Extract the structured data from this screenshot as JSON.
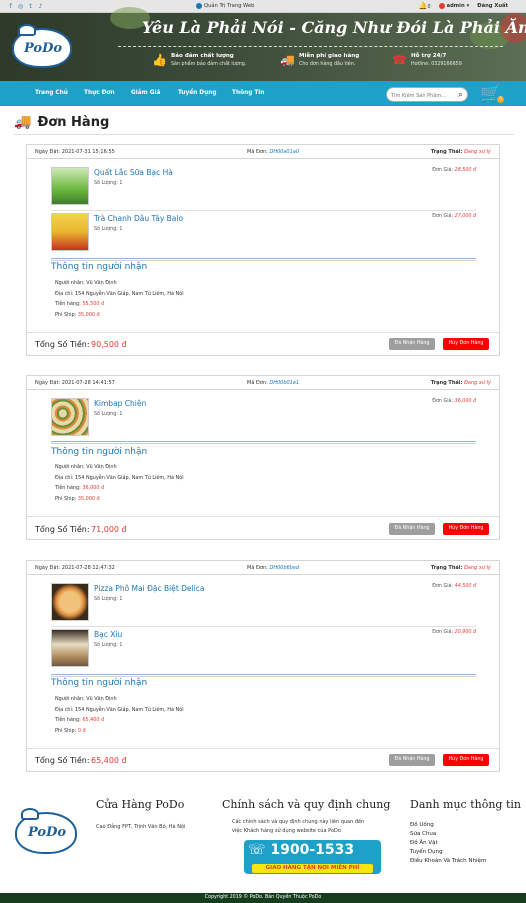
{
  "topbar": {
    "admin_link": "Quản Trị Trang Web",
    "bell_count": "0",
    "user_count": "0",
    "user_name": "admin",
    "logout": "Đăng Xuất"
  },
  "header": {
    "logo_text": "PoDo",
    "slogan": "Yêu Là Phải Nói - Căng Như Đói Là Phải Ăn",
    "features": [
      {
        "title": "Bảo đảm chất lượng",
        "desc": "Sản phẩm bảo đảm chất lượng."
      },
      {
        "title": "Miễn phí giao hàng",
        "desc": "Cho đơn hàng đầu tiên."
      },
      {
        "title": "Hỗ trợ 24/7",
        "desc": "Hotline: 0329166659"
      }
    ]
  },
  "nav": {
    "items": [
      "Trang Chủ",
      "Thực Đơn",
      "Giảm Giá",
      "Tuyển Dụng",
      "Thông Tin"
    ],
    "search_placeholder": "Tìm Kiếm Sản Phẩm...",
    "cart_count": "0"
  },
  "page": {
    "title": "Đơn Hàng"
  },
  "labels": {
    "order_date": "Ngày Đặt:",
    "order_code": "Mã Đơn:",
    "status": "Trạng Thái:",
    "price": "Đơn Giá:",
    "qty": "Số Lượng:",
    "recipient_title": "Thông tin người nhận",
    "recipient": "Người nhận:",
    "address": "Địa chỉ:",
    "goods": "Tiền hàng:",
    "ship": "Phí Ship:",
    "total": "Tổng Số Tiền:",
    "received_btn": "Đã Nhận Hàng",
    "cancel_btn": "Hủy Đơn Hàng"
  },
  "orders": [
    {
      "date": "2021-07-31 15:16:55",
      "code": "DH00a01a0",
      "status": "Đang xử lý",
      "products": [
        {
          "name": "Quất Lắc Sữa Bạc Hà",
          "qty": "1",
          "price": "28,500 đ"
        },
        {
          "name": "Trà Chanh Dâu Tây Balo",
          "qty": "1",
          "price": "27,000 đ"
        }
      ],
      "recipient": "Vũ Văn Định",
      "address": "154 Nguyễn Văn Giáp, Nam Từ Liêm, Hà Nội",
      "goods": "55,500 đ",
      "ship": "35,000 đ",
      "total": "90,500 đ"
    },
    {
      "date": "2021-07-28 14:41:57",
      "code": "DH00b01e1",
      "status": "Đang xử lý",
      "products": [
        {
          "name": "Kimbap Chiên",
          "qty": "1",
          "price": "36,000 đ"
        }
      ],
      "recipient": "Vũ Văn Định",
      "address": "154 Nguyễn Văn Giáp, Nam Từ Liêm, Hà Nội",
      "goods": "36,000 đ",
      "ship": "35,000 đ",
      "total": "71,000 đ"
    },
    {
      "date": "2021-07-28 12:47:32",
      "code": "DH00b6bed",
      "status": "Đang xử lý",
      "products": [
        {
          "name": "Pizza Phô Mai Đặc Biệt Delica",
          "qty": "1",
          "price": "44,500 đ"
        },
        {
          "name": "Bạc Xỉu",
          "qty": "1",
          "price": "20,900 đ"
        }
      ],
      "recipient": "Vũ Văn Định",
      "address": "154 Nguyễn Văn Giáp, Nam Từ Liêm, Hà Nội",
      "goods": "65,400 đ",
      "ship": "0 đ",
      "total": "65,400 đ"
    }
  ],
  "footer": {
    "store_title": "Cửa Hàng PoDo",
    "store_address": "Cao Đẳng FPT, Trịnh Văn Bô, Hà Nội",
    "policy_title": "Chính sách và quy định chung",
    "policy_text_1": "Các chính sách và quy định chung này liên quan đến",
    "policy_text_2": "việc Khách hàng sử dụng website của PoDo",
    "hotline": "1900-1533",
    "hotline_sub": "GIAO HÀNG TẬN NƠI MIỄN PHÍ",
    "category_title": "Danh mục thông tin",
    "categories": [
      "Đồ Uống",
      "Sữa Chua",
      "Đồ Ăn Vặt",
      "Tuyển Dụng",
      "Điều Khoản Và Trách Nhiệm"
    ],
    "copyright": "Copyright 2019 © PoDo. Bản Quyền Thuộc PoDo"
  },
  "colors": {
    "accent": "#1da1c8",
    "price_red": "#e53935",
    "link_blue": "#1976b8",
    "footer_bar": "#153d1d"
  }
}
